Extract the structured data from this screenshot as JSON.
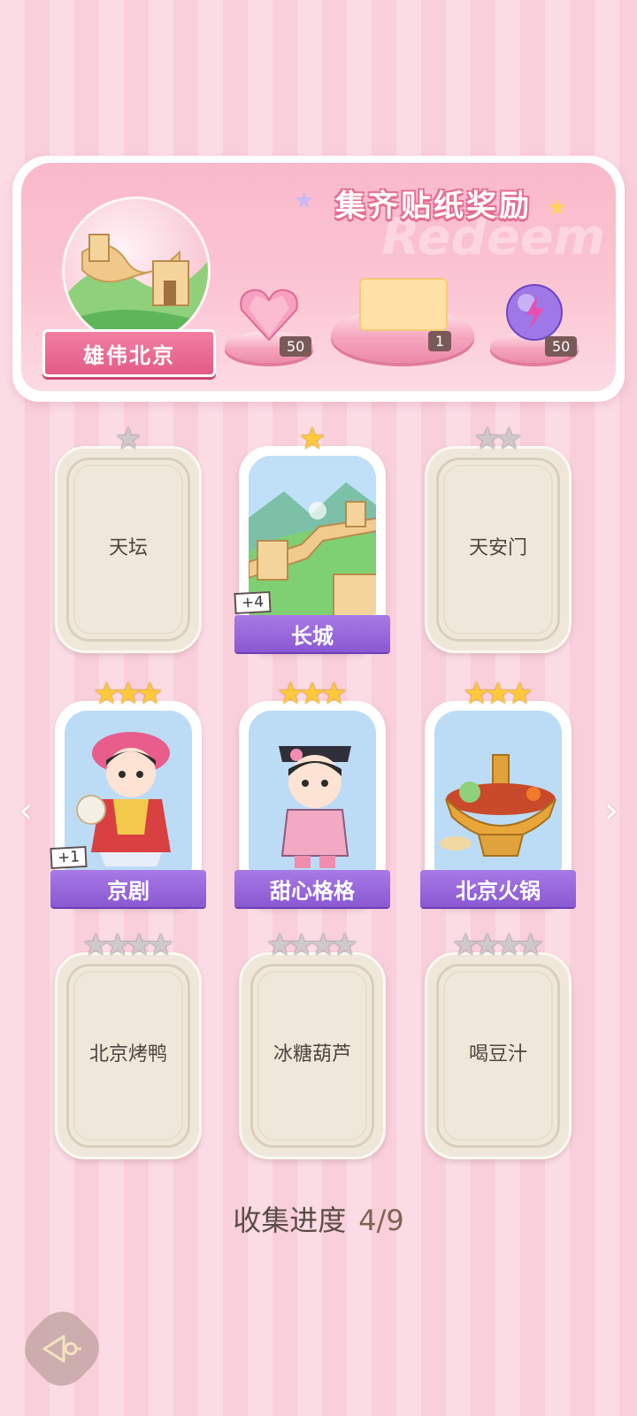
{
  "header": {
    "reward_title": "集齐贴纸奖励",
    "region_name": "雄伟北京",
    "rewards": [
      {
        "icon": "heart-gem-icon",
        "count": "50"
      },
      {
        "icon": "sticker-frame-icon",
        "count": "1"
      },
      {
        "icon": "energy-orb-icon",
        "count": "50"
      }
    ]
  },
  "cards": [
    {
      "name": "天坛",
      "stars_total": 1,
      "stars_earned": 0,
      "collected": false
    },
    {
      "name": "长城",
      "stars_total": 1,
      "stars_earned": 1,
      "collected": true,
      "extra": "+4"
    },
    {
      "name": "天安门",
      "stars_total": 2,
      "stars_earned": 0,
      "collected": false
    },
    {
      "name": "京剧",
      "stars_total": 3,
      "stars_earned": 3,
      "collected": true,
      "extra": "+1"
    },
    {
      "name": "甜心格格",
      "stars_total": 3,
      "stars_earned": 3,
      "collected": true
    },
    {
      "name": "北京火锅",
      "stars_total": 3,
      "stars_earned": 3,
      "collected": true
    },
    {
      "name": "北京烤鸭",
      "stars_total": 4,
      "stars_earned": 0,
      "collected": false
    },
    {
      "name": "冰糖葫芦",
      "stars_total": 4,
      "stars_earned": 0,
      "collected": false
    },
    {
      "name": "喝豆汁",
      "stars_total": 4,
      "stars_earned": 0,
      "collected": false
    }
  ],
  "progress": {
    "label": "收集进度",
    "value": "4/9"
  },
  "nav": {
    "prev_icon": "chevron-left-icon",
    "next_icon": "chevron-right-icon",
    "back_icon": "back-arrow-icon"
  },
  "colors": {
    "accent_pink": "#e35c86",
    "label_purple": "#8a58d2",
    "star_gold": "#ffc93a",
    "star_gray": "#cfc9cc"
  }
}
